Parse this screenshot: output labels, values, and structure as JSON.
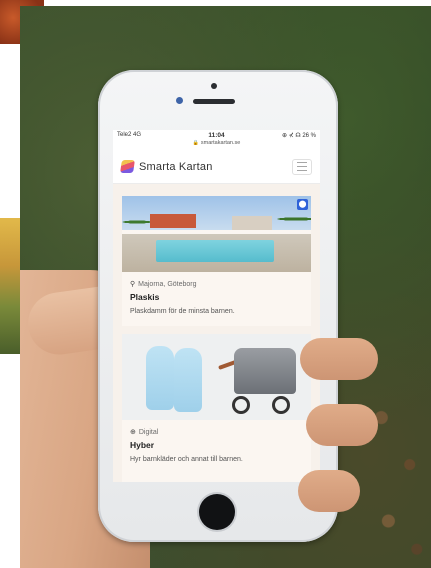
{
  "status_bar": {
    "carrier": "Tele2 4G",
    "time": "11:04",
    "battery": "⊕ ⊀ ☊ 26 %"
  },
  "browser": {
    "url": "smartakartan.se"
  },
  "navbar": {
    "brand": "Smarta Kartan"
  },
  "listings": [
    {
      "location": "Majorna, Göteborg",
      "title": "Plaskis",
      "description": "Plaskdamm för de minsta barnen."
    },
    {
      "location": "Digital",
      "title": "Hyber",
      "description": "Hyr barnkläder och annat till barnen."
    }
  ],
  "icons": {
    "location_pin": "map-pin-icon",
    "globe": "globe-icon",
    "menu": "hamburger-menu-icon",
    "map_marker_badge": "map-marker-icon"
  }
}
